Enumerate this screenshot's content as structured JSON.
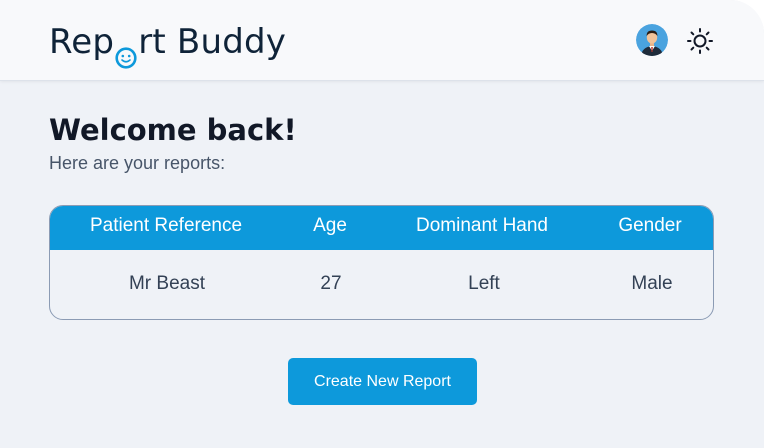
{
  "app": {
    "logo_part1": "Rep",
    "logo_part2": "rt Buddy",
    "logo_face_icon": "smiley-o-icon",
    "avatar_icon": "user-avatar-icon",
    "theme_icon": "sun-icon"
  },
  "main": {
    "heading": "Welcome back!",
    "subtitle": "Here are your reports:"
  },
  "table": {
    "columns": [
      "Patient Reference",
      "Age",
      "Dominant Hand",
      "Gender"
    ],
    "rows": [
      [
        "Mr Beast",
        "27",
        "Left",
        "Male"
      ]
    ]
  },
  "actions": {
    "create_label": "Create New Report"
  },
  "colors": {
    "accent": "#0d99db",
    "background": "#eff2f7",
    "header_bg": "#f8f9fb",
    "text_dark": "#111827"
  }
}
